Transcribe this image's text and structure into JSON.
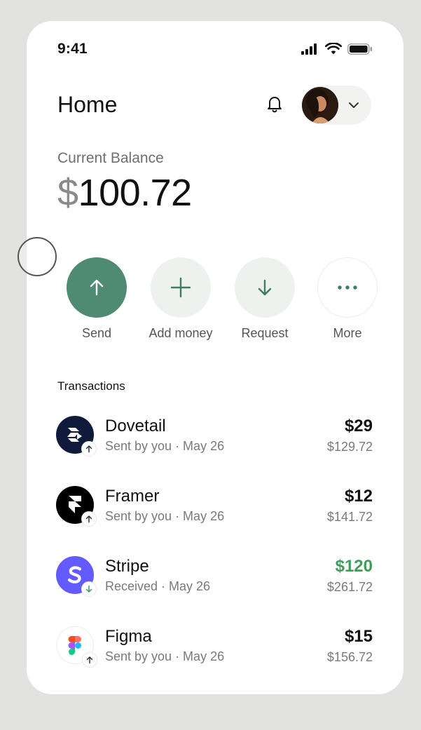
{
  "status_bar": {
    "time": "9:41",
    "icons": [
      "signal-icon",
      "wifi-icon",
      "battery-icon"
    ]
  },
  "header": {
    "title": "Home",
    "icons": [
      "bell-icon",
      "avatar",
      "chevron-down-icon"
    ]
  },
  "balance": {
    "label": "Current Balance",
    "currency": "$",
    "amount": "100.72"
  },
  "actions": [
    {
      "label": "Send",
      "icon": "arrow-up-icon"
    },
    {
      "label": "Add money",
      "icon": "plus-icon"
    },
    {
      "label": "Request",
      "icon": "arrow-down-icon"
    },
    {
      "label": "More",
      "icon": "more-icon"
    }
  ],
  "transactions": {
    "heading": "Transactions",
    "items": [
      {
        "name": "Dovetail",
        "subtitle": "Sent by you · May 26",
        "amount": "$29",
        "balance": "$129.72",
        "direction": "sent",
        "logo_color": "#101a3a"
      },
      {
        "name": "Framer",
        "subtitle": "Sent by you · May 26",
        "amount": "$12",
        "balance": "$141.72",
        "direction": "sent",
        "logo_color": "#000000"
      },
      {
        "name": "Stripe",
        "subtitle": "Received · May 26",
        "amount": "$120",
        "balance": "$261.72",
        "direction": "received",
        "logo_color": "#635bff"
      },
      {
        "name": "Figma",
        "subtitle": "Sent by you · May 26",
        "amount": "$15",
        "balance": "$156.72",
        "direction": "sent",
        "logo_color": "#ffffff"
      }
    ]
  },
  "colors": {
    "accent": "#4f8a73",
    "positive": "#3f9d58",
    "muted_text": "#7a7a7a"
  }
}
